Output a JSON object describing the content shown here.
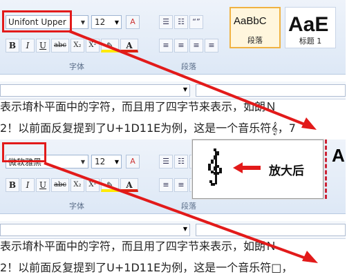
{
  "panel1": {
    "font_name": "Unifont Upper",
    "font_size": "12",
    "group_font": "字体",
    "group_paragraph": "段落",
    "styles": [
      {
        "sample": "AaBbC",
        "label": "段落"
      },
      {
        "sample": "AaE",
        "label": "标题 1"
      }
    ],
    "doc_line1": "表示堉朴平面中的字符，而且用了四字节来表示，如朗Ｎ",
    "doc_line2": "2！以前面反复提到了U+1D11E为例，这是一个音乐符𝄞，7"
  },
  "panel2": {
    "font_name": "微软雅黑",
    "font_size": "12",
    "group_font": "字体",
    "group_paragraph": "段落",
    "styles_partial": "A",
    "doc_line1": "表示堉朴平面中的字符，而且用了四字节来表示，如朗Ｎ",
    "doc_line2": "2！以前面反复提到了U+1D11E为例，这是一个音乐符□，"
  },
  "zoom": {
    "label": "放大后",
    "glyph": "treble-clef"
  },
  "format_buttons": [
    "B",
    "I",
    "U",
    "abc",
    "X₂",
    "X²",
    "A",
    "A"
  ],
  "colors": {
    "highlight_red": "#e21a1a",
    "style_selected": "#f0b242",
    "ribbon_top": "#eef3fa",
    "ribbon_bottom": "#dde8f6"
  }
}
